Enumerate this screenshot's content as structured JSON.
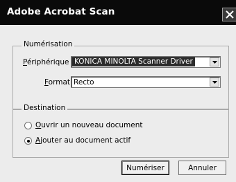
{
  "window": {
    "title": "Adobe Acrobat Scan"
  },
  "scan_group": {
    "legend": "Numérisation",
    "device_label": "Périphérique",
    "device_value": "KONICA MINOLTA Scanner Driver",
    "format_label": "Format",
    "format_value": "Recto"
  },
  "destination_group": {
    "legend": "Destination",
    "options": [
      {
        "label": "Ouvrir un nouveau document",
        "selected": false
      },
      {
        "label": "Ajouter au document actif",
        "selected": true
      }
    ]
  },
  "buttons": {
    "scan": "Numériser",
    "cancel": "Annuler"
  }
}
